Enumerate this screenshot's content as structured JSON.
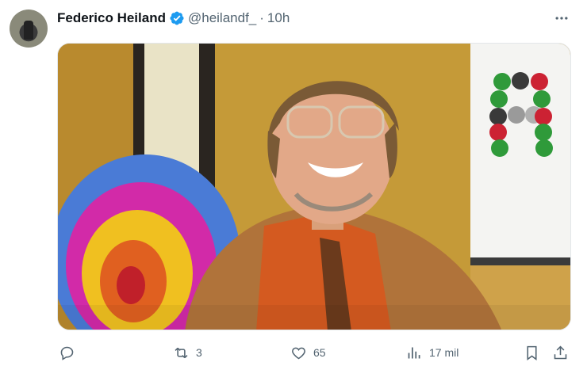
{
  "post": {
    "author_name": "Federico Heiland",
    "handle": "@heilandf_",
    "separator": "·",
    "time": "10h"
  },
  "actions": {
    "replies_count": "",
    "reposts_count": "3",
    "likes_count": "65",
    "views_count": "17 mil"
  },
  "colors": {
    "verified_badge": "#1d9bf0",
    "secondary_text": "#536471"
  },
  "icons": [
    "verified-badge-icon",
    "more-options-icon",
    "reply-icon",
    "repost-icon",
    "like-icon",
    "views-icon",
    "bookmark-icon",
    "share-icon"
  ]
}
